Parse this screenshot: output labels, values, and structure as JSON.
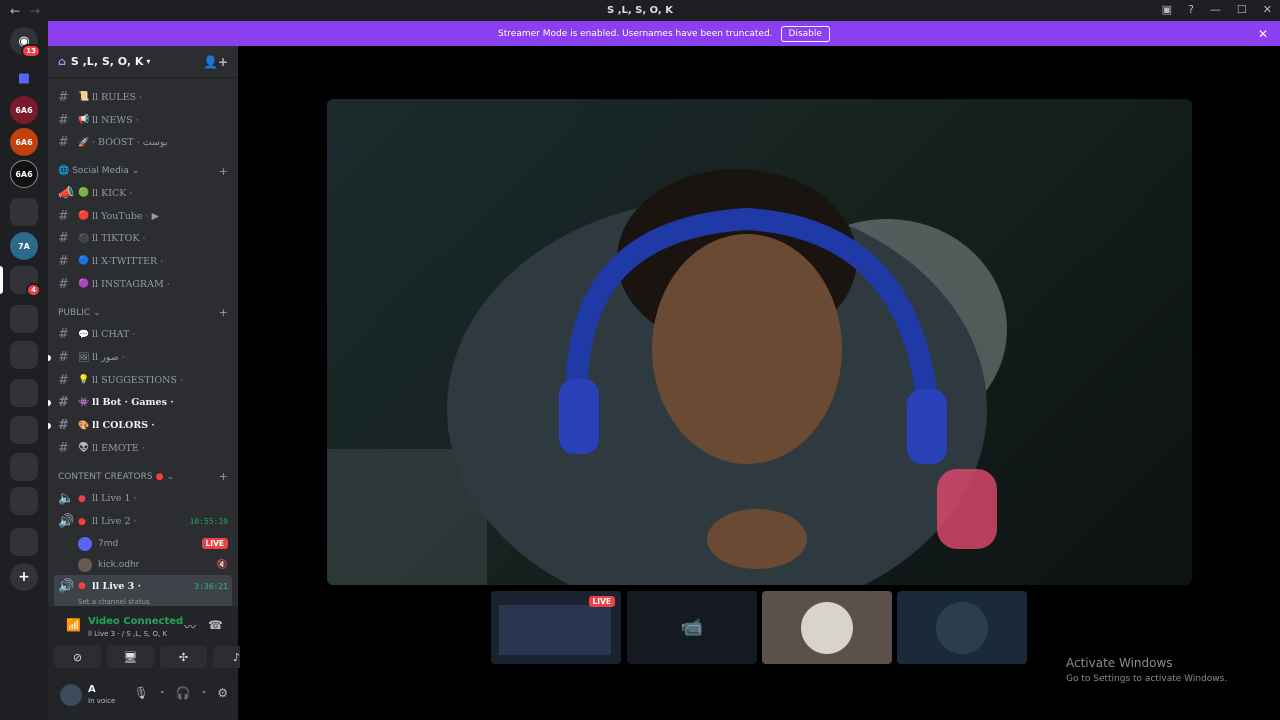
{
  "window": {
    "title": "S ,L, S, O, K"
  },
  "banner": {
    "message": "Streamer Mode is enabled. Usernames have been truncated.",
    "disable_label": "Disable"
  },
  "guilds": {
    "home_badge": "13",
    "server_badge": "4"
  },
  "server": {
    "name": "S ,L, S, O, K"
  },
  "channels_top": [
    {
      "icon": "📜",
      "label": "ll RULES ·"
    },
    {
      "icon": "📢",
      "label": "ll NEWS ·"
    },
    {
      "icon": "🚀",
      "label": "· BOOST · بوست"
    }
  ],
  "category_social": {
    "label": "Social Media"
  },
  "channels_social": [
    {
      "icon": "🟢",
      "label": "ll KICK ·"
    },
    {
      "icon": "🔴",
      "label": "ll YouTube · ▶"
    },
    {
      "icon": "⚫",
      "label": "ll TIKTOK ·"
    },
    {
      "icon": "🔵",
      "label": "ll X-TWITTER ·"
    },
    {
      "icon": "🟣",
      "label": "ll INSTAGRAM ·"
    }
  ],
  "category_public": {
    "label": "PUBLIC"
  },
  "channels_public": [
    {
      "icon": "💬",
      "label": "ll CHAT ·",
      "bold": false
    },
    {
      "icon": "🖼",
      "label": "ll صور ·",
      "bold": false
    },
    {
      "icon": "💡",
      "label": "ll SUGGESTIONS ·",
      "bold": false
    },
    {
      "icon": "👾",
      "label": "ll Bot · Games ·",
      "bold": true
    },
    {
      "icon": "🎨",
      "label": "ll COLORS ·",
      "bold": true
    },
    {
      "icon": "👽",
      "label": "ll EMOTE ·",
      "bold": false
    }
  ],
  "category_creators": {
    "label": "CONTENT CREATORS"
  },
  "voice": {
    "live1": "ll Live 1 ·",
    "live2": "ll Live 2 ·",
    "live2_timer": "10:55:10",
    "user1": "7md",
    "live_badge": "LIVE",
    "user2": "kick.odhr",
    "live3": "ll Live 3 ·",
    "live3_timer": "3:36:21",
    "set_status": "Set a channel status"
  },
  "voice_panel": {
    "status": "Video Connected",
    "sub": "ll Live 3 · / S ,L, S, O, K"
  },
  "user_panel": {
    "name": "A",
    "status": "In voice"
  },
  "stage": {
    "tile_live_badge": "LIVE"
  },
  "watermark": {
    "title": "Activate Windows",
    "sub": "Go to Settings to activate Windows."
  },
  "colors": {
    "accent": "#8c3ff0",
    "live": "#ed4245",
    "connected": "#23a55a"
  }
}
